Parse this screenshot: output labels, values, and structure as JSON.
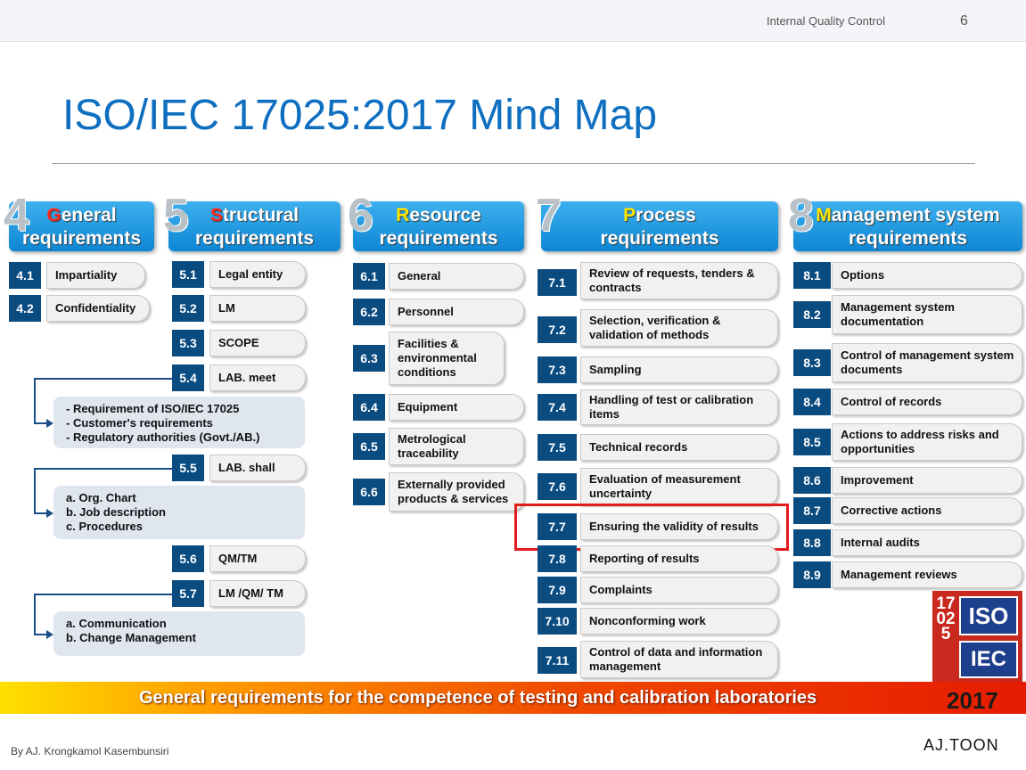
{
  "header": {
    "section": "Internal Quality Control",
    "page": "6"
  },
  "title": "ISO/IEC 17025:2017 Mind Map",
  "columns": [
    {
      "num": "4",
      "initial": "G",
      "rest": "eneral",
      "line2": "requirements",
      "items": [
        {
          "code": "4.1",
          "label": "Impartiality"
        },
        {
          "code": "4.2",
          "label": "Confidentiality"
        }
      ]
    },
    {
      "num": "5",
      "initial": "S",
      "rest": "tructural",
      "line2": "requirements",
      "items": [
        {
          "code": "5.1",
          "label": "Legal entity"
        },
        {
          "code": "5.2",
          "label": "LM"
        },
        {
          "code": "5.3",
          "label": "SCOPE"
        },
        {
          "code": "5.4",
          "label": "LAB. meet"
        },
        {
          "code": "5.5",
          "label": "LAB. shall"
        },
        {
          "code": "5.6",
          "label": "QM/TM"
        },
        {
          "code": "5.7",
          "label": "LM /QM/ TM"
        }
      ],
      "notes": [
        [
          "-   Requirement of ISO/IEC 17025",
          "-   Customer's requirements",
          "-   Regulatory authorities (Govt./AB.)"
        ],
        [
          "a.  Org. Chart",
          "b.  Job description",
          "c.  Procedures"
        ],
        [
          "a.  Communication",
          "b.  Change Management"
        ]
      ]
    },
    {
      "num": "6",
      "initial": "R",
      "rest": "esource",
      "line2": "requirements",
      "items": [
        {
          "code": "6.1",
          "label": "General"
        },
        {
          "code": "6.2",
          "label": "Personnel"
        },
        {
          "code": "6.3",
          "label": "Facilities & environmental conditions"
        },
        {
          "code": "6.4",
          "label": "Equipment"
        },
        {
          "code": "6.5",
          "label": "Metrological traceability"
        },
        {
          "code": "6.6",
          "label": "Externally provided products & services"
        }
      ]
    },
    {
      "num": "7",
      "initial": "P",
      "rest": "rocess",
      "line2": "requirements",
      "items": [
        {
          "code": "7.1",
          "label": "Review of requests, tenders & contracts"
        },
        {
          "code": "7.2",
          "label": "Selection, verification & validation of methods"
        },
        {
          "code": "7.3",
          "label": "Sampling"
        },
        {
          "code": "7.4",
          "label": "Handling of test or calibration items"
        },
        {
          "code": "7.5",
          "label": "Technical records"
        },
        {
          "code": "7.6",
          "label": "Evaluation of measurement uncertainty"
        },
        {
          "code": "7.7",
          "label": "Ensuring the validity of results"
        },
        {
          "code": "7.8",
          "label": "Reporting of results"
        },
        {
          "code": "7.9",
          "label": "Complaints"
        },
        {
          "code": "7.10",
          "label": "Nonconforming work"
        },
        {
          "code": "7.11",
          "label": "Control of data and information management"
        }
      ]
    },
    {
      "num": "8",
      "initial": "M",
      "rest": "anagement system",
      "line2": "requirements",
      "items": [
        {
          "code": "8.1",
          "label": "Options"
        },
        {
          "code": "8.2",
          "label": "Management system documentation"
        },
        {
          "code": "8.3",
          "label": "Control of management system documents"
        },
        {
          "code": "8.4",
          "label": "Control of records"
        },
        {
          "code": "8.5",
          "label": "Actions to address risks and opportunities"
        },
        {
          "code": "8.6",
          "label": "Improvement"
        },
        {
          "code": "8.7",
          "label": "Corrective actions"
        },
        {
          "code": "8.8",
          "label": "Internal audits"
        },
        {
          "code": "8.9",
          "label": "Management reviews"
        }
      ]
    }
  ],
  "banner": {
    "text": "General requirements for the competence of testing and calibration laboratories",
    "year": "2017"
  },
  "logo": {
    "digits": "17025",
    "iso": "ISO",
    "iec": "IEC"
  },
  "footer": {
    "author": "By AJ. Krongkamol Kasembunsiri",
    "brand": "AJ.TOON"
  },
  "colors": {
    "title": "#0e6fc0",
    "box": "#0a4b80",
    "highlight": "#e21b1b"
  }
}
